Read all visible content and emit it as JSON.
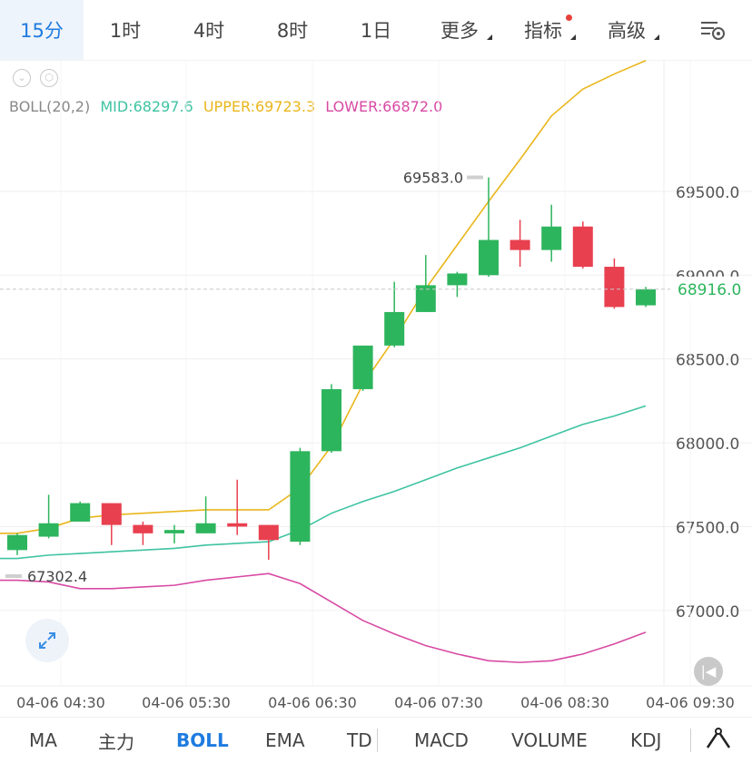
{
  "tabs": [
    {
      "label": "15分",
      "active": true,
      "has_dropdown": false,
      "has_dot": false
    },
    {
      "label": "1时",
      "active": false,
      "has_dropdown": false,
      "has_dot": false
    },
    {
      "label": "4时",
      "active": false,
      "has_dropdown": false,
      "has_dot": false
    },
    {
      "label": "8时",
      "active": false,
      "has_dropdown": false,
      "has_dot": false
    },
    {
      "label": "1日",
      "active": false,
      "has_dropdown": false,
      "has_dot": false
    },
    {
      "label": "更多",
      "active": false,
      "has_dropdown": true,
      "has_dot": false
    },
    {
      "label": "指标",
      "active": false,
      "has_dropdown": true,
      "has_dot": true
    },
    {
      "label": "高级",
      "active": false,
      "has_dropdown": true,
      "has_dot": false
    }
  ],
  "settings_icon": "chart-settings-icon",
  "legend": {
    "name": "BOLL(20,2)",
    "mid": "MID:68297.6",
    "upper": "UPPER:69723.3",
    "lower": "LOWER:66872.0"
  },
  "bottom_tabs": [
    {
      "label": "MA",
      "active": false
    },
    {
      "label": "主力",
      "active": false
    },
    {
      "label": "BOLL",
      "active": true
    },
    {
      "label": "EMA",
      "active": false
    },
    {
      "label": "TD",
      "active": false
    },
    {
      "label": "MACD",
      "active": false
    },
    {
      "label": "VOLUME",
      "active": false
    },
    {
      "label": "KDJ",
      "active": false
    }
  ],
  "colors": {
    "up": "#2db55d",
    "down": "#e8404f",
    "mid": "#3fc3a2",
    "upper": "#e9b61c",
    "lower": "#d84aa4",
    "active_tab": "#1f7be0",
    "last_price": "#2db55d"
  },
  "chart_data": {
    "type": "candlestick",
    "xlabel_ticks": [
      "04-06 04:30",
      "04-06 05:30",
      "04-06 06:30",
      "04-06 07:30",
      "04-06 08:30",
      "04-06 09:30"
    ],
    "ytick_labels": [
      "69500.0",
      "69000.0",
      "68500.0",
      "68000.0",
      "67500.0",
      "67000.0"
    ],
    "y_ticks": [
      69500,
      69000,
      68500,
      68000,
      67500,
      67000
    ],
    "ylim": [
      66550,
      70230
    ],
    "candles": [
      {
        "o": 67360,
        "h": 67460,
        "l": 67330,
        "c": 67450
      },
      {
        "o": 67440,
        "h": 67690,
        "l": 67430,
        "c": 67520
      },
      {
        "o": 67530,
        "h": 67650,
        "l": 67530,
        "c": 67640
      },
      {
        "o": 67640,
        "h": 67640,
        "l": 67390,
        "c": 67510
      },
      {
        "o": 67510,
        "h": 67530,
        "l": 67390,
        "c": 67460
      },
      {
        "o": 67460,
        "h": 67510,
        "l": 67400,
        "c": 67480
      },
      {
        "o": 67460,
        "h": 67680,
        "l": 67460,
        "c": 67520
      },
      {
        "o": 67520,
        "h": 67780,
        "l": 67450,
        "c": 67500
      },
      {
        "o": 67510,
        "h": 67510,
        "l": 67302.4,
        "c": 67420
      },
      {
        "o": 67410,
        "h": 67970,
        "l": 67390,
        "c": 67950
      },
      {
        "o": 67950,
        "h": 68350,
        "l": 67940,
        "c": 68320
      },
      {
        "o": 68320,
        "h": 68580,
        "l": 68310,
        "c": 68580
      },
      {
        "o": 68580,
        "h": 68960,
        "l": 68570,
        "c": 68780
      },
      {
        "o": 68780,
        "h": 69120,
        "l": 68780,
        "c": 68940
      },
      {
        "o": 68940,
        "h": 69020,
        "l": 68870,
        "c": 69010
      },
      {
        "o": 69000,
        "h": 69583.0,
        "l": 68990,
        "c": 69210
      },
      {
        "o": 69210,
        "h": 69330,
        "l": 69050,
        "c": 69150
      },
      {
        "o": 69150,
        "h": 69420,
        "l": 69080,
        "c": 69290
      },
      {
        "o": 69290,
        "h": 69320,
        "l": 69040,
        "c": 69050
      },
      {
        "o": 69050,
        "h": 69100,
        "l": 68800,
        "c": 68810
      },
      {
        "o": 68820,
        "h": 68930,
        "l": 68810,
        "c": 68916.0
      }
    ],
    "series": [
      {
        "name": "UPPER",
        "values": [
          67460,
          67490,
          67550,
          67570,
          67580,
          67590,
          67600,
          67600,
          67600,
          67730,
          67980,
          68350,
          68620,
          68920,
          69180,
          69440,
          69690,
          69950,
          70110,
          70200,
          70280
        ]
      },
      {
        "name": "MID",
        "values": [
          67310,
          67330,
          67340,
          67350,
          67360,
          67370,
          67390,
          67400,
          67410,
          67480,
          67580,
          67650,
          67710,
          67780,
          67850,
          67910,
          67970,
          68040,
          68110,
          68160,
          68220
        ]
      },
      {
        "name": "LOWER",
        "values": [
          67180,
          67170,
          67130,
          67130,
          67140,
          67150,
          67180,
          67200,
          67220,
          67160,
          67050,
          66940,
          66860,
          66790,
          66740,
          66700,
          66690,
          66700,
          66740,
          66800,
          66870
        ]
      }
    ],
    "max_label": "69583.0",
    "min_label": "67302.4",
    "last_price_label": "68916.0",
    "last_price": 68916.0
  }
}
